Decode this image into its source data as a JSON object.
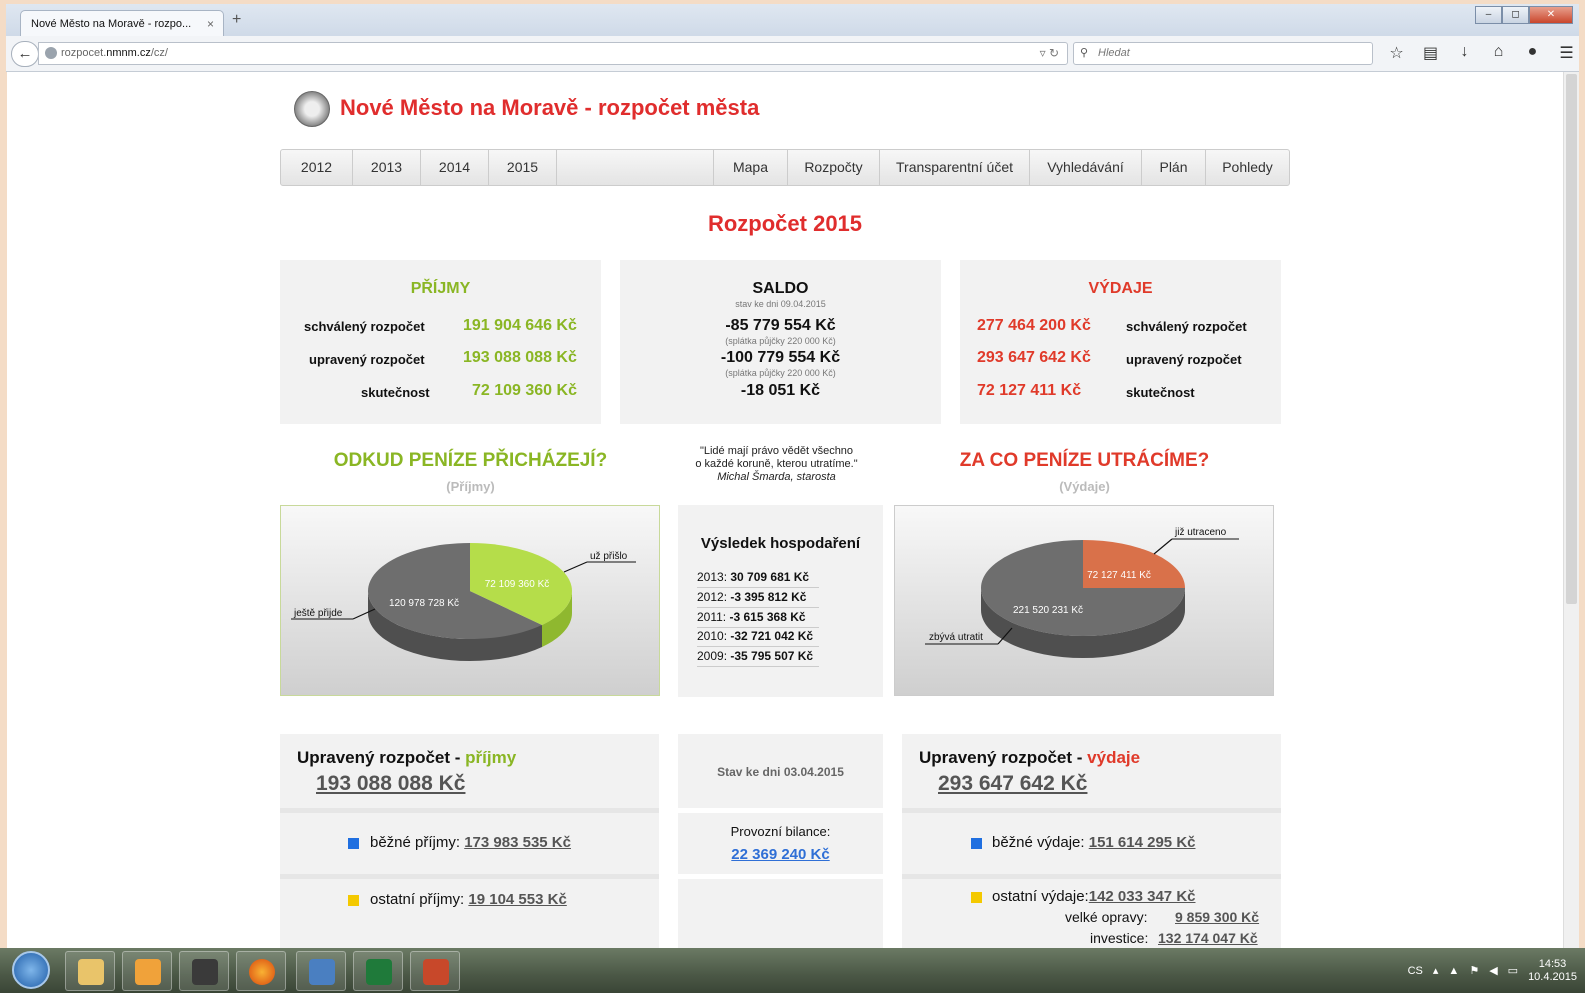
{
  "browser": {
    "tab_title": "Nové Město na Moravě - rozpo...",
    "tab_close": "×",
    "new_tab": "+",
    "url_prefix": "rozpocet.",
    "url_domain": "nmnm.cz",
    "url_path": "/cz/",
    "search_placeholder": "Hledat",
    "win_minimize": "–",
    "win_restore": "◻",
    "win_close": "✕"
  },
  "site": {
    "title": "Nové Město na Moravě - rozpočet města"
  },
  "menu": {
    "years": [
      "2012",
      "2013",
      "2014",
      "2015"
    ],
    "right": [
      "Mapa",
      "Rozpočty",
      "Transparentní účet",
      "Vyhledávání",
      "Plán",
      "Pohledy"
    ]
  },
  "heading": "Rozpočet 2015",
  "prijmy": {
    "title": "PŘÍJMY",
    "rows": [
      {
        "label": "schválený rozpočet",
        "value": "191 904 646 Kč"
      },
      {
        "label": "upravený rozpočet",
        "value": "193 088 088 Kč"
      },
      {
        "label": "skutečnost",
        "value": "72 109 360 Kč"
      }
    ]
  },
  "saldo": {
    "title": "SALDO",
    "date": "stav ke dni 09.04.2015",
    "v1": "-85 779 554 Kč",
    "n1": "(splátka půjčky 220 000 Kč)",
    "v2": "-100 779 554 Kč",
    "n2": "(splátka půjčky 220 000 Kč)",
    "v3": "-18 051 Kč"
  },
  "vydaje": {
    "title": "VÝDAJE",
    "rows": [
      {
        "label": "schválený rozpočet",
        "value": "277 464 200 Kč"
      },
      {
        "label": "upravený rozpočet",
        "value": "293 647 642 Kč"
      },
      {
        "label": "skutečnost",
        "value": "72 127 411 Kč"
      }
    ]
  },
  "sections": {
    "odkud": "ODKUD PENÍZE PŘICHÁZEJÍ?",
    "odkud_sub": "(Příjmy)",
    "zaco": "ZA CO PENÍZE UTRÁCÍME?",
    "zaco_sub": "(Výdaje)"
  },
  "quote": {
    "line1": "\"Lidé mají právo vědět všechno",
    "line2": "o každé koruně, kterou utratíme.\"",
    "author": "Michal Šmarda, starosta"
  },
  "pie_income": {
    "slice_in": "72 109 360 Kč",
    "slice_rest": "120 978 728 Kč",
    "callout_in": "už přišlo",
    "callout_rest": "ještě přijde"
  },
  "pie_expense": {
    "slice_spent": "72 127 411 Kč",
    "slice_rest": "221 520 231 Kč",
    "callout_spent": "již utraceno",
    "callout_rest": "zbývá utratit"
  },
  "vysledek": {
    "title": "Výsledek hospodaření",
    "rows": [
      {
        "year": "2013:",
        "value": "30 709 681 Kč"
      },
      {
        "year": "2012:",
        "value": "-3 395 812 Kč"
      },
      {
        "year": "2011:",
        "value": "-3 615 368 Kč"
      },
      {
        "year": "2010:",
        "value": "-32 721 042 Kč"
      },
      {
        "year": "2009:",
        "value": "-35 795 507 Kč"
      }
    ]
  },
  "upraveny_prijmy": {
    "title": "Upravený rozpočet - ",
    "accent": "příjmy",
    "sum": "193 088 088 Kč",
    "bezne_label": "běžné příjmy: ",
    "bezne_value": "173 983 535 Kč",
    "ostatni_label": "ostatní příjmy: ",
    "ostatni_value": "19 104 553 Kč"
  },
  "stav": {
    "date": "Stav ke dni 03.04.2015",
    "bilance_label": "Provozní bilance:",
    "bilance_value": "22 369 240 Kč"
  },
  "upraveny_vydaje": {
    "title": "Upravený rozpočet - ",
    "accent": "výdaje",
    "sum": "293 647 642 Kč",
    "bezne_label": "běžné výdaje: ",
    "bezne_value": "151 614 295 Kč",
    "ostatni_label": "ostatní výdaje:",
    "ostatni_value": "142 033 347 Kč",
    "opravy_label": "velké opravy:",
    "opravy_value": "9 859 300 Kč",
    "investice_label": "investice:",
    "investice_value": "132 174 047 Kč"
  },
  "taskbar": {
    "lang": "CS",
    "time": "14:53",
    "date": "10.4.2015"
  },
  "colors": {
    "accent_red": "#e02d2d",
    "income_green": "#8ab624",
    "pie_green": "#b5dd4a",
    "pie_orange": "#d9714a",
    "pie_grey": "#6e6e6e",
    "link_blue": "#2f6fd6",
    "square_blue": "#1f6fe0",
    "square_yellow": "#f4c900"
  }
}
